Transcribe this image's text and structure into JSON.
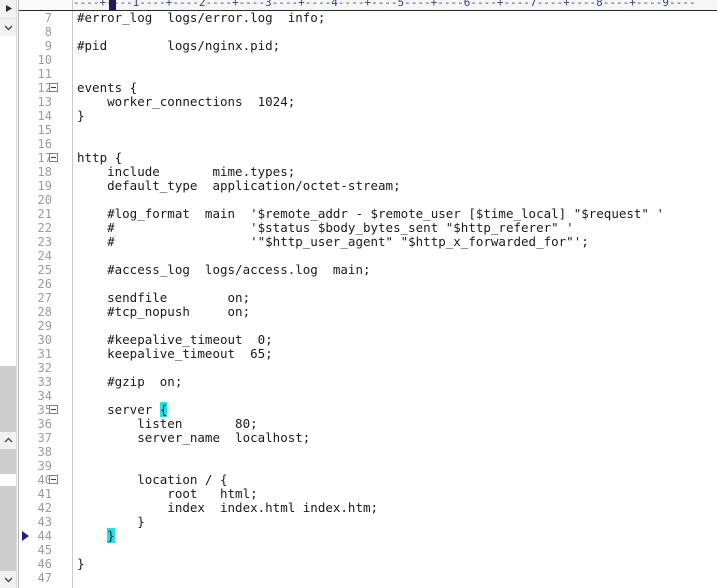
{
  "app": {
    "kind": "source-code-editor",
    "file_type": "nginx.conf",
    "colors": {
      "background": "#ffffff",
      "text": "#1a1a1a",
      "line_number": "#9b9b9b",
      "ruler": "#3b3b8f",
      "brace_highlight": "#26e0e8",
      "bookmark_marker": "#1c1c8c",
      "scrollbar_thumb": "#cdcdcd"
    }
  },
  "ruler": {
    "ticks": "----+----1----+----2----+----3----+----4----+----5----+----6----+----7----+----8----+----9----",
    "caret_column": 6
  },
  "scrollbar": {
    "up_arrow_icon": "triangle-right-icon",
    "collapse_icon": "chevron-down-icon",
    "expand_icon": "chevron-up-icon",
    "down_arrow_icon": "chevron-down-icon"
  },
  "editor": {
    "first_visible_line": 7,
    "last_visible_line": 47,
    "bookmarked_line": 44,
    "fold_lines": [
      12,
      17,
      35,
      40
    ],
    "highlighted_braces": [
      35,
      44
    ],
    "lines": [
      {
        "n": 7,
        "text": "#error_log  logs/error.log  info;"
      },
      {
        "n": 8,
        "text": ""
      },
      {
        "n": 9,
        "text": "#pid        logs/nginx.pid;"
      },
      {
        "n": 10,
        "text": ""
      },
      {
        "n": 11,
        "text": ""
      },
      {
        "n": 12,
        "text": "events {"
      },
      {
        "n": 13,
        "text": "    worker_connections  1024;"
      },
      {
        "n": 14,
        "text": "}"
      },
      {
        "n": 15,
        "text": ""
      },
      {
        "n": 16,
        "text": ""
      },
      {
        "n": 17,
        "text": "http {"
      },
      {
        "n": 18,
        "text": "    include       mime.types;"
      },
      {
        "n": 19,
        "text": "    default_type  application/octet-stream;"
      },
      {
        "n": 20,
        "text": ""
      },
      {
        "n": 21,
        "text": "    #log_format  main  '$remote_addr - $remote_user [$time_local] \"$request\" '"
      },
      {
        "n": 22,
        "text": "    #                  '$status $body_bytes_sent \"$http_referer\" '"
      },
      {
        "n": 23,
        "text": "    #                  '\"$http_user_agent\" \"$http_x_forwarded_for\"';"
      },
      {
        "n": 24,
        "text": ""
      },
      {
        "n": 25,
        "text": "    #access_log  logs/access.log  main;"
      },
      {
        "n": 26,
        "text": ""
      },
      {
        "n": 27,
        "text": "    sendfile        on;"
      },
      {
        "n": 28,
        "text": "    #tcp_nopush     on;"
      },
      {
        "n": 29,
        "text": ""
      },
      {
        "n": 30,
        "text": "    #keepalive_timeout  0;"
      },
      {
        "n": 31,
        "text": "    keepalive_timeout  65;"
      },
      {
        "n": 32,
        "text": ""
      },
      {
        "n": 33,
        "text": "    #gzip  on;"
      },
      {
        "n": 34,
        "text": ""
      },
      {
        "n": 35,
        "text": "    server ",
        "brace": "{"
      },
      {
        "n": 36,
        "text": "        listen       80;"
      },
      {
        "n": 37,
        "text": "        server_name  localhost;"
      },
      {
        "n": 38,
        "text": ""
      },
      {
        "n": 39,
        "text": ""
      },
      {
        "n": 40,
        "text": "        location / {"
      },
      {
        "n": 41,
        "text": "            root   html;"
      },
      {
        "n": 42,
        "text": "            index  index.html index.htm;"
      },
      {
        "n": 43,
        "text": "        }"
      },
      {
        "n": 44,
        "text": "    ",
        "brace": "}"
      },
      {
        "n": 45,
        "text": ""
      },
      {
        "n": 46,
        "text": "}"
      },
      {
        "n": 47,
        "text": ""
      }
    ]
  }
}
